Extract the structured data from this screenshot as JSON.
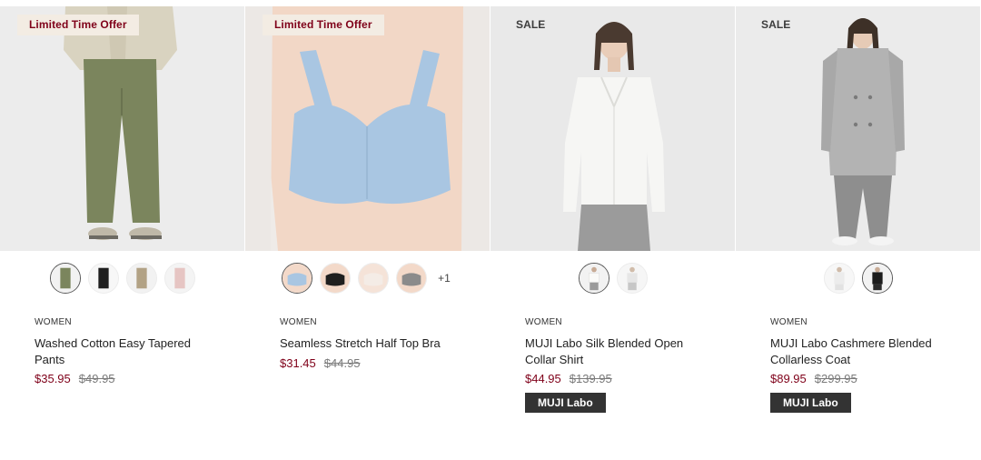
{
  "products": [
    {
      "badge": "Limited Time Offer",
      "category": "WOMEN",
      "name": "Washed Cotton Easy Tapered Pants",
      "sale_price": "$35.95",
      "orig_price": "$49.95",
      "more": "",
      "tag": "",
      "swatches": [
        {
          "color": "#7b855d",
          "label": "olive"
        },
        {
          "color": "#1f1f1f",
          "label": "black"
        },
        {
          "color": "#b2a285",
          "label": "beige"
        },
        {
          "color": "#e6c5c3",
          "label": "pink"
        }
      ]
    },
    {
      "badge": "Limited Time Offer",
      "category": "WOMEN",
      "name": "Seamless Stretch Half Top Bra",
      "sale_price": "$31.45",
      "orig_price": "$44.95",
      "more": "+1",
      "tag": "",
      "swatches": [
        {
          "color": "#a9c6e2",
          "label": "light-blue"
        },
        {
          "color": "#1f1f1f",
          "label": "black"
        },
        {
          "color": "#f4ece6",
          "label": "off-white"
        },
        {
          "color": "#8b8b8b",
          "label": "gray"
        }
      ]
    },
    {
      "badge": "SALE",
      "category": "WOMEN",
      "name": "MUJI Labo Silk Blended Open Collar Shirt",
      "sale_price": "$44.95",
      "orig_price": "$139.95",
      "more": "",
      "tag": "MUJI Labo",
      "swatches": [
        {
          "color": "#f4f4f2",
          "label": "white"
        },
        {
          "color": "#d8d8d8",
          "label": "light-gray"
        }
      ]
    },
    {
      "badge": "SALE",
      "category": "WOMEN",
      "name": "MUJI Labo Cashmere Blended Collarless Coat",
      "sale_price": "$89.95",
      "orig_price": "$299.95",
      "more": "",
      "tag": "MUJI Labo",
      "swatches": [
        {
          "color": "#eeeeee",
          "label": "ivory"
        },
        {
          "color": "#1c1c1c",
          "label": "black"
        }
      ]
    }
  ]
}
